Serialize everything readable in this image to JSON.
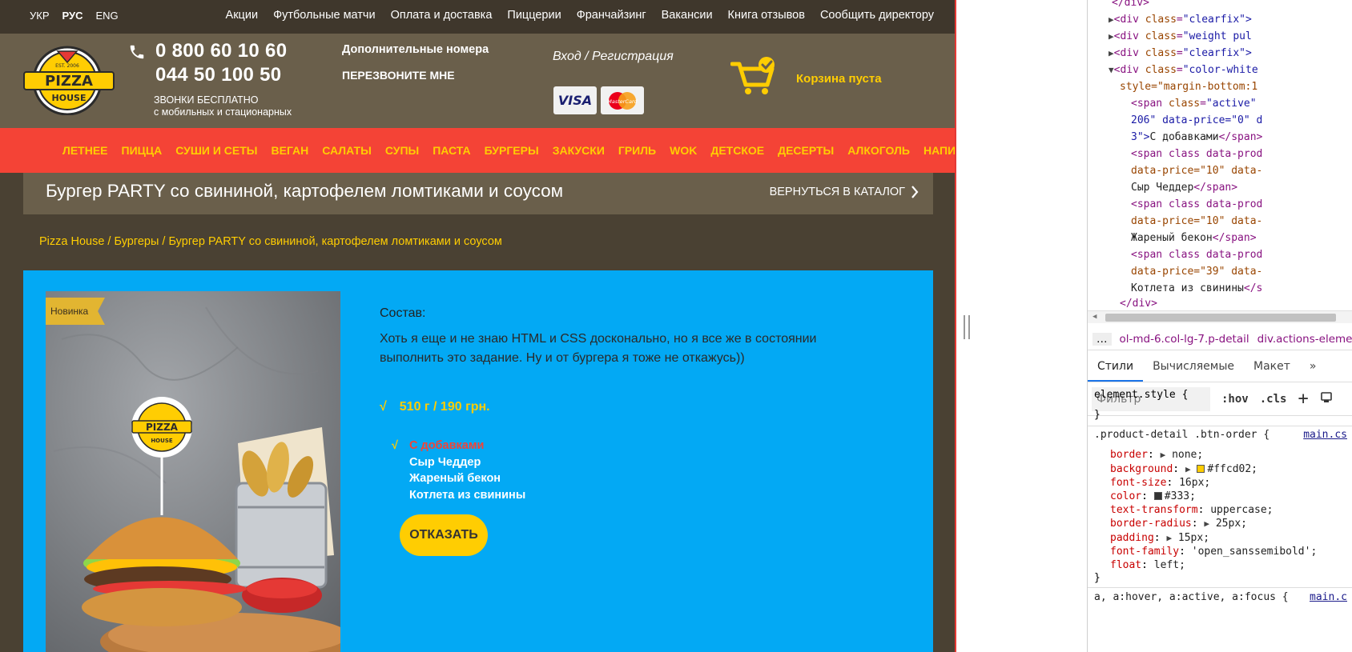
{
  "topbar": {
    "languages": [
      "УКР",
      "РУС",
      "ENG"
    ],
    "nav": [
      "Акции",
      "Футбольные матчи",
      "Оплата и доставка",
      "Пиццерии",
      "Франчайзинг",
      "Вакансии",
      "Книга отзывов",
      "Сообщить директору"
    ]
  },
  "header": {
    "logo_text": "PIZZA HOUSE",
    "logo_est": "EST. 2006",
    "phone1": "0 800 60 10 60",
    "phone2": "044 50 100 50",
    "calls_note_line1": "ЗВОНКИ БЕСПЛАТНО",
    "calls_note_line2": "с мобильных и стационарных",
    "extra_numbers": "Дополнительные номера",
    "callback": "ПЕРЕЗВОНИТЕ МНЕ",
    "login": "Вход / Регистрация",
    "visa": "VISA",
    "mastercard": "MasterCard",
    "cart": "Корзина пуста"
  },
  "categories": [
    "ЛЕТНЕЕ",
    "ПИЦЦА",
    "СУШИ И СЕТЫ",
    "ВЕГАН",
    "САЛАТЫ",
    "СУПЫ",
    "ПАСТА",
    "БУРГЕРЫ",
    "ЗАКУСКИ",
    "ГРИЛЬ",
    "WOK",
    "ДЕТСКОЕ",
    "ДЕСЕРТЫ",
    "АЛКОГОЛЬ",
    "НАПИТКИ"
  ],
  "page": {
    "title": "Бургер PARTY со свининой, картофелем ломтиками и соусом",
    "back": "ВЕРНУТЬСЯ В КАТАЛОГ",
    "breadcrumb": [
      "Pizza House",
      "Бургеры",
      "Бургер PARTY со свининой, картофелем ломтиками и соусом"
    ],
    "breadcrumb_sep": " / "
  },
  "product": {
    "badge": "Новинка",
    "composition_label": "Состав:",
    "description": "Хоть я еще и не знаю HTML и CSS досконально, но я все же в состоянии выполнить это задание. Ну и от бургера я тоже не откажусь))",
    "check": "√",
    "weight_price": "510 г / 190 грн.",
    "addons": [
      {
        "label": "С добавками",
        "active": true
      },
      {
        "label": "Сыр Чеддер",
        "active": false
      },
      {
        "label": "Жареный бекон",
        "active": false
      },
      {
        "label": "Котлета из свинины",
        "active": false
      }
    ],
    "order_button": "ОТКАЗАТЬ"
  },
  "devtools": {
    "dom": {
      "line0": "</div>",
      "clearfix1": "\"clearfix\">",
      "weight": "\"weight pul",
      "clearfix2": "\"clearfix\">",
      "colorwhite": "\"color-white",
      "style_attr": "style=\"margin-bottom:1",
      "span_active": "\"active\"",
      "span_206": "206\" data-price=\"0\" d",
      "text1": "С добавками",
      "span2_a": "<span class data-prod",
      "span2_b": "data-price=\"10\" data-",
      "text2": "Сыр Чеддер",
      "span3_a": "<span class data-prod",
      "span3_b": "data-price=\"10\" data-",
      "text3": "Жареный бекон",
      "span4_a": "<span class data-prod",
      "span4_b": "data-price=\"39\" data-",
      "text4": "Котлета из свинины",
      "close_div": "</div>"
    },
    "breadcrumb": [
      "…",
      "ol-md-6.col-lg-7.p-detail",
      "div.actions-eleme"
    ],
    "tabs": [
      "Стили",
      "Вычисляемые",
      "Макет",
      "»"
    ],
    "filter_placeholder": "Фильтр",
    "tools": [
      ":hov",
      ".cls",
      "+"
    ],
    "element_style": "element.style {",
    "close_brace": "}",
    "rule_selector": ".product-detail .btn-order {",
    "rule_source": "main.cs",
    "props": [
      {
        "name": "border",
        "value": "none;",
        "expand": true
      },
      {
        "name": "background",
        "value": "#ffcd02;",
        "expand": true,
        "swatch": "#ffcd02"
      },
      {
        "name": "font-size",
        "value": "16px;"
      },
      {
        "name": "color",
        "value": "#333;",
        "swatch": "#333333"
      },
      {
        "name": "text-transform",
        "value": "uppercase;"
      },
      {
        "name": "border-radius",
        "value": "25px;",
        "expand": true
      },
      {
        "name": "padding",
        "value": "15px;",
        "expand": true
      },
      {
        "name": "font-family",
        "value": "'open_sanssemibold';"
      },
      {
        "name": "float",
        "value": "left;"
      }
    ],
    "next_selector": "a, a:hover, a:active, a:focus {",
    "next_source": "main.c"
  },
  "colors": {
    "accent_yellow": "#ffcd02",
    "nav_red": "#f44336",
    "product_blue": "#03a9f4",
    "header_brown": "#6a5f4b"
  }
}
